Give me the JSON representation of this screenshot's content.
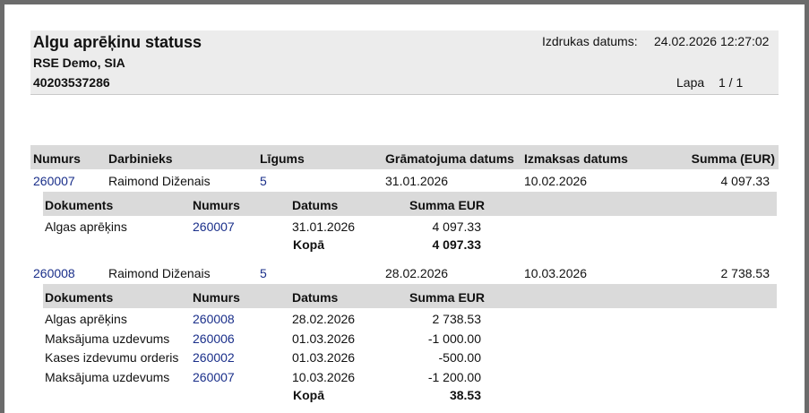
{
  "report": {
    "title": "Algu aprēķinu statuss",
    "company": "RSE Demo, SIA",
    "reg_number": "40203537286",
    "print_date_label": "Izdrukas datums:",
    "print_date": "24.02.2026 12:27:02",
    "page_label": "Lapa",
    "page_value": "1 / 1"
  },
  "columns": {
    "numurs": "Numurs",
    "darbinieks": "Darbinieks",
    "ligums": "Līgums",
    "gramatojuma_datums": "Grāmatojuma datums",
    "izmaksas_datums": "Izmaksas datums",
    "summa": "Summa (EUR)"
  },
  "sub_columns": {
    "dokuments": "Dokuments",
    "numurs": "Numurs",
    "datums": "Datums",
    "summa": "Summa EUR"
  },
  "total_label": "Kopā",
  "records": [
    {
      "numurs": "260007",
      "darbinieks": "Raimond Diženais",
      "ligums": "5",
      "gramatojuma_datums": "31.01.2026",
      "izmaksas_datums": "10.02.2026",
      "summa": "4 097.33",
      "documents": [
        {
          "dokuments": "Algas aprēķins",
          "numurs": "260007",
          "datums": "31.01.2026",
          "summa": "4 097.33"
        }
      ],
      "total": "4 097.33"
    },
    {
      "numurs": "260008",
      "darbinieks": "Raimond Diženais",
      "ligums": "5",
      "gramatojuma_datums": "28.02.2026",
      "izmaksas_datums": "10.03.2026",
      "summa": "2 738.53",
      "documents": [
        {
          "dokuments": "Algas aprēķins",
          "numurs": "260008",
          "datums": "28.02.2026",
          "summa": "2 738.53"
        },
        {
          "dokuments": "Maksājuma uzdevums",
          "numurs": "260006",
          "datums": "01.03.2026",
          "summa": "-1 000.00"
        },
        {
          "dokuments": "Kases izdevumu orderis",
          "numurs": "260002",
          "datums": "01.03.2026",
          "summa": "-500.00"
        },
        {
          "dokuments": "Maksājuma uzdevums",
          "numurs": "260007",
          "datums": "10.03.2026",
          "summa": "-1 200.00"
        }
      ],
      "total": "38.53"
    }
  ]
}
